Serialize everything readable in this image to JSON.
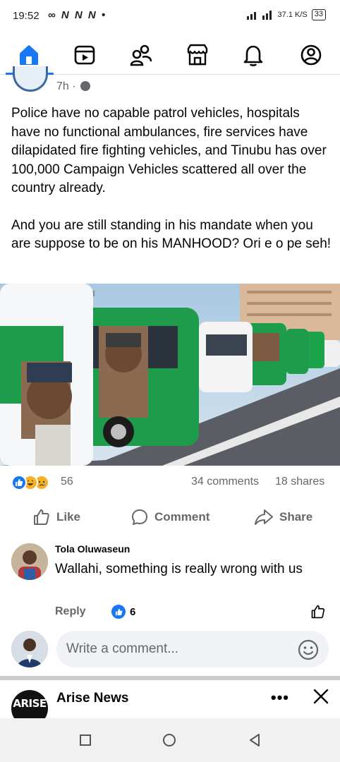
{
  "status_bar": {
    "time": "19:52",
    "left_icons": "∞ N N N •",
    "speed": "37.1 K/S",
    "battery": "33"
  },
  "nav": {
    "items": [
      "home-icon",
      "video-icon",
      "friends-icon",
      "marketplace-icon",
      "notifications-icon",
      "profile-icon"
    ],
    "active": "home",
    "accent": "#1877f2"
  },
  "post": {
    "time": "7h ·",
    "privacy_icon": "globe-icon",
    "paragraph_1": "Police have no capable patrol vehicles, hospitals have no functional ambulances, fire services have dilapidated fire fighting vehicles, and Tinubu has over 100,000 Campaign Vehicles scattered all over the country already.",
    "paragraph_2": "And you are still standing in his mandate when you are suppose to be on his MANHOOD? Ori e o pe seh!",
    "reactions_count": "56",
    "comments": "34 comments",
    "shares": "18 shares",
    "actions": {
      "like": "Like",
      "comment": "Comment",
      "share": "Share"
    }
  },
  "comment": {
    "author": "Tola Oluwaseun",
    "text": "Wallahi, something is really wrong with us",
    "reply": "Reply",
    "likes": "6"
  },
  "composer": {
    "placeholder": "Write a comment..."
  },
  "next_post": {
    "logo_text": "ARISE",
    "author": "Arise News",
    "more": "•••"
  }
}
